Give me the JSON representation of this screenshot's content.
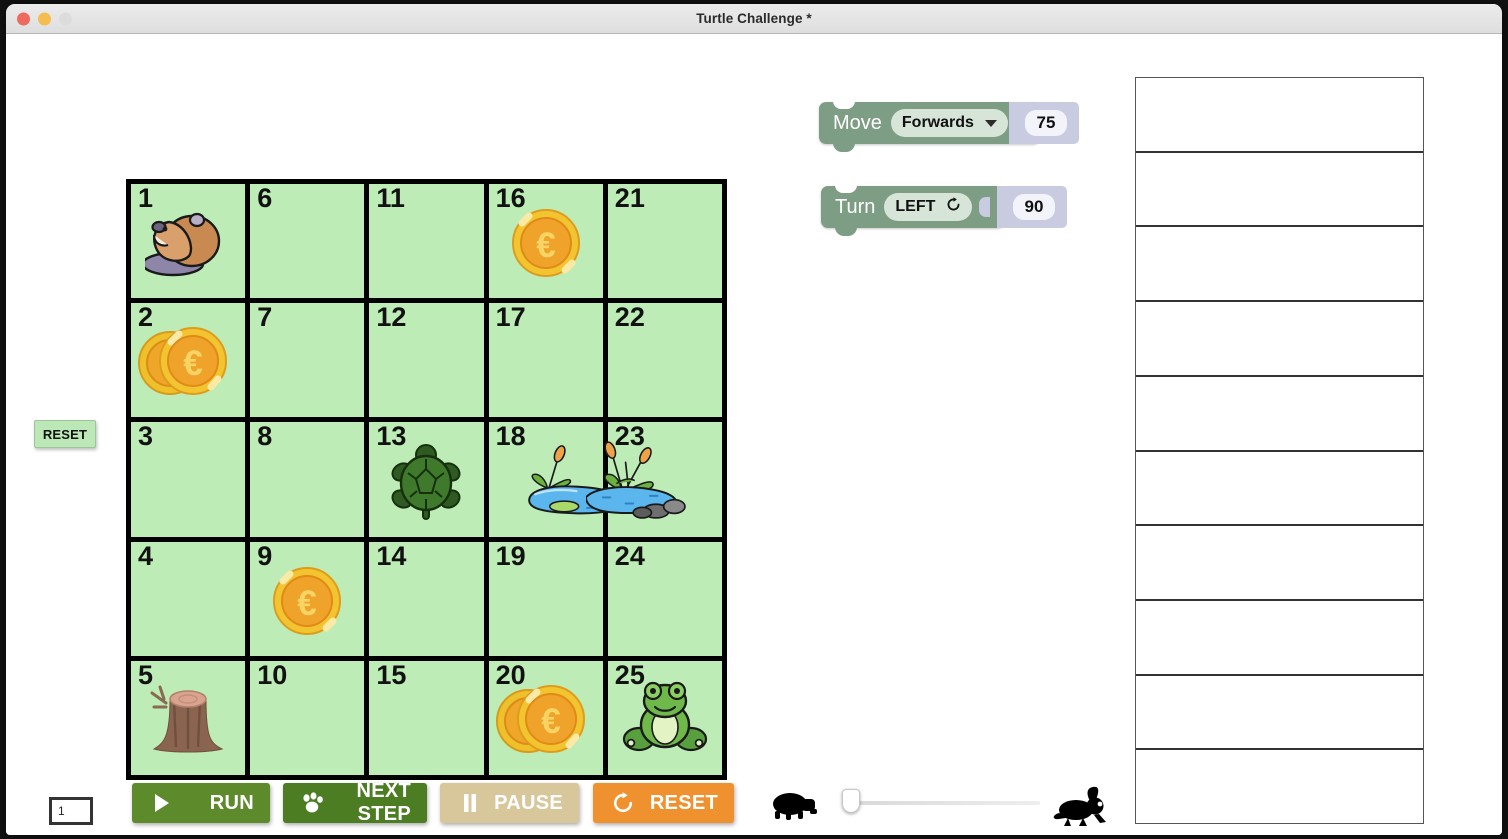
{
  "window": {
    "title": "Turtle Challenge *",
    "traffic_lights": [
      "close",
      "minimize",
      "zoom"
    ]
  },
  "side_reset": {
    "label": "RESET"
  },
  "board": {
    "rows": 5,
    "cols": 5,
    "cell_color": "#bdecb6",
    "grid_line_color": "#000000",
    "cells": [
      {
        "num": "1",
        "art": "beaver"
      },
      {
        "num": "6",
        "art": ""
      },
      {
        "num": "11",
        "art": ""
      },
      {
        "num": "16",
        "art": "coin"
      },
      {
        "num": "21",
        "art": ""
      },
      {
        "num": "2",
        "art": "coins"
      },
      {
        "num": "7",
        "art": ""
      },
      {
        "num": "12",
        "art": ""
      },
      {
        "num": "17",
        "art": ""
      },
      {
        "num": "22",
        "art": ""
      },
      {
        "num": "3",
        "art": ""
      },
      {
        "num": "8",
        "art": ""
      },
      {
        "num": "13",
        "art": "turtle"
      },
      {
        "num": "18",
        "art": "pond-left"
      },
      {
        "num": "23",
        "art": "pond-right"
      },
      {
        "num": "4",
        "art": ""
      },
      {
        "num": "9",
        "art": "coin"
      },
      {
        "num": "14",
        "art": ""
      },
      {
        "num": "19",
        "art": ""
      },
      {
        "num": "24",
        "art": ""
      },
      {
        "num": "5",
        "art": "stump"
      },
      {
        "num": "10",
        "art": ""
      },
      {
        "num": "15",
        "art": ""
      },
      {
        "num": "20",
        "art": "coins"
      },
      {
        "num": "25",
        "art": "frog"
      }
    ]
  },
  "blocks": {
    "move": {
      "label": "Move",
      "direction": "Forwards",
      "dropdown_icon": "chevron-down-icon",
      "value": "75",
      "color": "#7e9d85",
      "value_color": "#c9cce0"
    },
    "turn": {
      "label": "Turn",
      "direction": "LEFT",
      "rotate_icon": "rotate-clockwise-icon",
      "value": "90",
      "color": "#7e9d85",
      "value_color": "#c9cce0"
    }
  },
  "program_panel": {
    "slot_count": 10,
    "slots": [
      "",
      "",
      "",
      "",
      "",
      "",
      "",
      "",
      "",
      ""
    ]
  },
  "toolbar": {
    "run": {
      "label": "RUN",
      "icon": "play-icon",
      "color": "#5d8b2c"
    },
    "next_step": {
      "label": "NEXT STEP",
      "icon": "paw-print-icon",
      "color": "#4c7d22"
    },
    "pause": {
      "label": "PAUSE",
      "icon": "pause-icon",
      "color": "#d9c79c"
    },
    "reset": {
      "label": "RESET",
      "icon": "refresh-circle-icon",
      "color": "#f0912f"
    }
  },
  "step_counter": {
    "value": "1"
  },
  "speed_slider": {
    "slow_icon": "turtle-icon",
    "fast_icon": "rabbit-icon",
    "thumb_position_percent": 2
  }
}
